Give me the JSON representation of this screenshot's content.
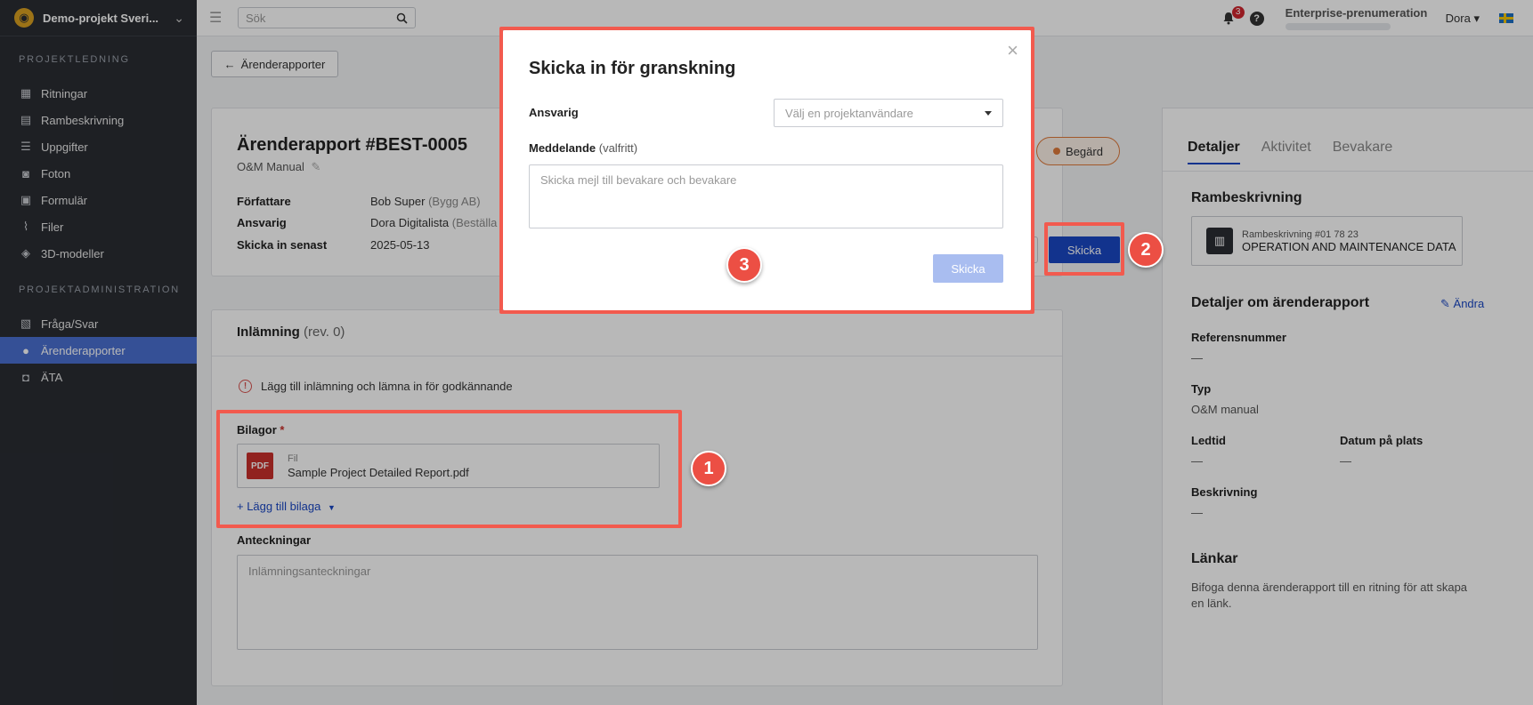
{
  "sidebar": {
    "project": "Demo-projekt Sveri...",
    "section1": "PROJEKTLEDNING",
    "items1": [
      {
        "label": "Ritningar",
        "icon": "drawings-icon"
      },
      {
        "label": "Rambeskrivning",
        "icon": "spec-icon"
      },
      {
        "label": "Uppgifter",
        "icon": "tasks-icon"
      },
      {
        "label": "Foton",
        "icon": "camera-icon"
      },
      {
        "label": "Formulär",
        "icon": "forms-icon"
      },
      {
        "label": "Filer",
        "icon": "paperclip-icon"
      },
      {
        "label": "3D-modeller",
        "icon": "cube-icon"
      }
    ],
    "section2": "PROJEKTADMINISTRATION",
    "items2": [
      {
        "label": "Fråga/Svar",
        "icon": "qa-icon"
      },
      {
        "label": "Ärenderapporter",
        "icon": "person-icon"
      },
      {
        "label": "ÄTA",
        "icon": "ata-icon"
      }
    ]
  },
  "topbar": {
    "search_placeholder": "Sök",
    "notif_count": "3",
    "help": "?",
    "enterprise": "Enterprise-prenumeration",
    "user": "Dora ▾"
  },
  "main": {
    "back_label": "Ärenderapporter",
    "report_title": "Ärenderapport #BEST-0005",
    "report_sub": "O&M Manual",
    "status": "Begärd",
    "meta": {
      "author_k": "Författare",
      "author_v": "Bob Super",
      "author_org": "(Bygg AB)",
      "resp_k": "Ansvarig",
      "resp_v": "Dora Digitalista",
      "resp_org": "(Beställa",
      "deadline_k": "Skicka in senast",
      "deadline_v": "2025-05-13"
    },
    "send_button": "Skicka",
    "submission": {
      "title": "Inlämning",
      "rev": "(rev. 0)",
      "warning": "Lägg till inlämning och lämna in för godkännande",
      "attachments_label": "Bilagor",
      "required": "*",
      "file_type_label": "Fil",
      "file_badge": "PDF",
      "file_name": "Sample Project Detailed Report.pdf",
      "add_attachment": "+ Lägg till bilaga",
      "notes_label": "Anteckningar",
      "notes_placeholder": "Inlämningsanteckningar"
    }
  },
  "right_panel": {
    "tabs": [
      "Detaljer",
      "Aktivitet",
      "Bevakare"
    ],
    "spec_heading": "Rambeskrivning",
    "spec_number": "Rambeskrivning #01 78 23",
    "spec_name": "OPERATION AND MAINTENANCE DATA",
    "details_heading": "Detaljer om ärenderapport",
    "edit": "Ändra",
    "ref_k": "Referensnummer",
    "ref_v": "—",
    "type_k": "Typ",
    "type_v": "O&M manual",
    "lead_k": "Ledtid",
    "lead_v": "—",
    "site_k": "Datum på plats",
    "site_v": "—",
    "desc_k": "Beskrivning",
    "desc_v": "—",
    "links_heading": "Länkar",
    "links_text": "Bifoga denna ärenderapport till en ritning för att skapa en länk."
  },
  "modal": {
    "title": "Skicka in för granskning",
    "resp_label": "Ansvarig",
    "resp_placeholder": "Välj en projektanvändare",
    "msg_label": "Meddelande",
    "msg_optional": "(valfritt)",
    "msg_placeholder": "Skicka mejl till bevakare och bevakare",
    "send": "Skicka"
  },
  "annotations": [
    "1",
    "2",
    "3"
  ],
  "colors": {
    "accent": "#1a47c4",
    "highlight": "#f25a4e",
    "sidebar": "#2a2d33",
    "active": "#4a6fd0"
  }
}
